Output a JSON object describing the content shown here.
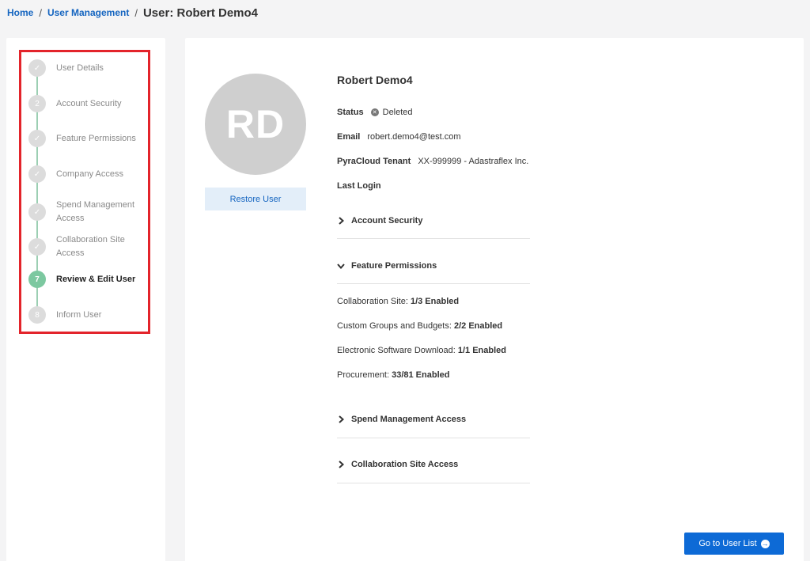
{
  "breadcrumb": {
    "home": "Home",
    "separator": "/",
    "user_management": "User Management",
    "current": "User: Robert Demo4"
  },
  "steps": [
    {
      "label": "User Details",
      "marker": "✓",
      "state": "complete"
    },
    {
      "label": "Account Security",
      "marker": "2",
      "state": "incomplete"
    },
    {
      "label": "Feature Permissions",
      "marker": "✓",
      "state": "complete"
    },
    {
      "label": "Company Access",
      "marker": "✓",
      "state": "complete"
    },
    {
      "label": "Spend Management Access",
      "marker": "✓",
      "state": "complete"
    },
    {
      "label": "Collaboration Site Access",
      "marker": "✓",
      "state": "complete"
    },
    {
      "label": "Review & Edit User",
      "marker": "7",
      "state": "active"
    },
    {
      "label": "Inform User",
      "marker": "8",
      "state": "incomplete"
    }
  ],
  "user": {
    "initials": "RD",
    "name": "Robert Demo4",
    "status_label": "Status",
    "status_value": "Deleted",
    "email_label": "Email",
    "email_value": "robert.demo4@test.com",
    "tenant_label": "PyraCloud Tenant",
    "tenant_value": "XX-999999 - Adastraflex Inc.",
    "last_login_label": "Last Login"
  },
  "restore_button": "Restore User",
  "sections": {
    "account_security": "Account Security",
    "feature_permissions": "Feature Permissions",
    "spend_management": "Spend Management Access",
    "collaboration_site": "Collaboration Site Access"
  },
  "permissions": [
    {
      "name": "Collaboration Site:",
      "value": "1/3 Enabled"
    },
    {
      "name": "Custom Groups and Budgets:",
      "value": "2/2 Enabled"
    },
    {
      "name": "Electronic Software Download:",
      "value": "1/1 Enabled"
    },
    {
      "name": "Procurement:",
      "value": "33/81 Enabled"
    }
  ],
  "go_button": "Go to User List",
  "colors": {
    "link": "#1565c0",
    "primary_button": "#0d6ad6",
    "active_step": "#7cc8a0",
    "highlight_border": "#e3242b"
  }
}
